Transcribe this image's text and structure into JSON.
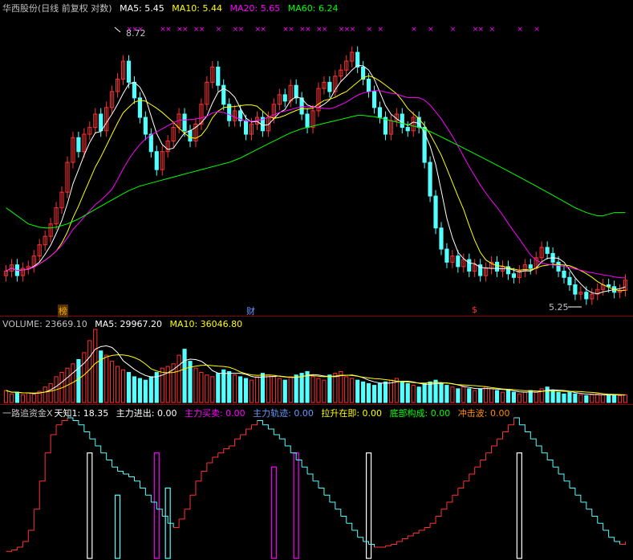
{
  "main_header": {
    "stock": "华西股份",
    "mode": "(日线 前复权 对数)",
    "ma5": "MA5: 5.45",
    "ma10": "MA10: 5.44",
    "ma20": "MA20: 5.65",
    "ma60": "MA60: 6.24"
  },
  "annotations": {
    "high": "8.72",
    "low": "5.25",
    "bang": "榜",
    "cai": "财",
    "dollar": "$"
  },
  "volume_header": {
    "volume": "VOLUME: 23669.10",
    "ma5": "MA5: 29967.20",
    "ma10": "MA10: 36046.80"
  },
  "indicator_header": {
    "name": "一路追资金X",
    "tianzhi": "天知1: 18.35",
    "zlyc": "主力进出: 0.00",
    "zlmm": "主力买卖: 0.00",
    "zlgj": "主力轨迹: 0.00",
    "lszj": "拉升在即: 0.00",
    "dbgc": "底部构成: 0.00",
    "cjb": "冲击波: 0.00"
  },
  "colors": {
    "up": "#ff3232",
    "down": "#54ffff",
    "ma5": "#ffffff",
    "ma10": "#ffff00",
    "ma20": "#ff00ff",
    "ma60": "#00ff00",
    "marker": "#ff00ff",
    "white": "#ffffff",
    "label_gray": "#c0c0c0",
    "label_blue": "#6699ff",
    "label_orange": "#ff8c00",
    "label_green": "#00ff00"
  },
  "chart_data": [
    {
      "type": "candlestick",
      "title": "华西股份 (日线 前复权 对数)",
      "ylim": [
        5.1,
        9.1
      ],
      "close": [
        5.55,
        5.62,
        5.5,
        5.58,
        5.6,
        5.72,
        5.85,
        5.95,
        6.1,
        6.3,
        6.5,
        6.9,
        7.25,
        7.05,
        7.3,
        7.4,
        7.6,
        7.35,
        7.7,
        7.95,
        8.15,
        8.45,
        8.1,
        7.85,
        7.55,
        7.3,
        7.05,
        6.8,
        7.05,
        7.2,
        7.4,
        7.6,
        7.35,
        7.2,
        7.45,
        7.75,
        8.1,
        8.35,
        8.05,
        7.75,
        7.5,
        7.65,
        7.5,
        7.3,
        7.45,
        7.55,
        7.35,
        7.55,
        7.75,
        7.9,
        7.8,
        8.05,
        7.85,
        7.6,
        7.4,
        7.65,
        8.0,
        8.1,
        7.95,
        8.2,
        8.3,
        8.45,
        8.6,
        8.35,
        8.15,
        7.95,
        7.7,
        7.55,
        7.3,
        7.5,
        7.6,
        7.4,
        7.35,
        7.55,
        7.4,
        6.9,
        6.45,
        6.05,
        5.8,
        5.65,
        5.72,
        5.6,
        5.68,
        5.55,
        5.62,
        5.5,
        5.58,
        5.65,
        5.55,
        5.6,
        5.52,
        5.48,
        5.55,
        5.62,
        5.58,
        5.7,
        5.82,
        5.75,
        5.65,
        5.55,
        5.48,
        5.4,
        5.3,
        5.32,
        5.25,
        5.3,
        5.35,
        5.4,
        5.38,
        5.32,
        5.34,
        5.45
      ],
      "open": [
        5.5,
        5.55,
        5.62,
        5.5,
        5.58,
        5.6,
        5.72,
        5.85,
        5.95,
        6.1,
        6.3,
        6.5,
        6.9,
        7.25,
        7.05,
        7.3,
        7.4,
        7.6,
        7.35,
        7.7,
        7.95,
        8.15,
        8.45,
        8.1,
        7.85,
        7.55,
        7.3,
        7.05,
        6.8,
        7.05,
        7.2,
        7.4,
        7.6,
        7.35,
        7.2,
        7.45,
        7.75,
        8.1,
        8.35,
        8.05,
        7.75,
        7.5,
        7.65,
        7.5,
        7.3,
        7.45,
        7.55,
        7.35,
        7.55,
        7.75,
        7.9,
        7.8,
        8.05,
        7.85,
        7.6,
        7.4,
        7.65,
        8.0,
        8.1,
        7.95,
        8.2,
        8.3,
        8.45,
        8.6,
        8.35,
        8.15,
        7.95,
        7.7,
        7.55,
        7.3,
        7.5,
        7.6,
        7.4,
        7.35,
        7.55,
        7.4,
        6.9,
        6.45,
        6.05,
        5.8,
        5.65,
        5.72,
        5.6,
        5.68,
        5.55,
        5.62,
        5.5,
        5.58,
        5.65,
        5.55,
        5.6,
        5.52,
        5.48,
        5.55,
        5.62,
        5.58,
        5.7,
        5.82,
        5.75,
        5.65,
        5.55,
        5.48,
        5.4,
        5.3,
        5.32,
        5.25,
        5.3,
        5.35,
        5.4,
        5.38,
        5.32,
        5.34
      ],
      "ma60": [
        6.3,
        6.25,
        6.2,
        6.15,
        6.1,
        6.08,
        6.06,
        6.05,
        6.05,
        6.06,
        6.08,
        6.1,
        6.13,
        6.16,
        6.2,
        6.24,
        6.28,
        6.32,
        6.36,
        6.4,
        6.44,
        6.48,
        6.52,
        6.55,
        6.58,
        6.6,
        6.62,
        6.64,
        6.66,
        6.68,
        6.7,
        6.72,
        6.74,
        6.76,
        6.78,
        6.8,
        6.82,
        6.84,
        6.86,
        6.88,
        6.9,
        6.93,
        6.96,
        7.0,
        7.04,
        7.08,
        7.12,
        7.16,
        7.2,
        7.24,
        7.28,
        7.32,
        7.35,
        7.38,
        7.4,
        7.42,
        7.44,
        7.46,
        7.48,
        7.5,
        7.52,
        7.54,
        7.56,
        7.58,
        7.58,
        7.57,
        7.56,
        7.54,
        7.52,
        7.5,
        7.48,
        7.46,
        7.44,
        7.42,
        7.4,
        7.37,
        7.34,
        7.3,
        7.26,
        7.22,
        7.18,
        7.14,
        7.1,
        7.06,
        7.02,
        6.98,
        6.94,
        6.9,
        6.86,
        6.82,
        6.78,
        6.74,
        6.7,
        6.66,
        6.62,
        6.58,
        6.54,
        6.5,
        6.46,
        6.42,
        6.38,
        6.34,
        6.3,
        6.27,
        6.24,
        6.22,
        6.2,
        6.2,
        6.22,
        6.24,
        6.24,
        6.24
      ]
    },
    {
      "type": "bar",
      "title": "VOLUME",
      "values": [
        14,
        10,
        12,
        9,
        11,
        10,
        13,
        18,
        22,
        30,
        35,
        40,
        45,
        50,
        58,
        72,
        85,
        60,
        55,
        48,
        42,
        38,
        35,
        30,
        28,
        26,
        30,
        35,
        40,
        42,
        45,
        55,
        62,
        48,
        40,
        35,
        32,
        30,
        34,
        38,
        36,
        32,
        30,
        28,
        26,
        30,
        34,
        32,
        30,
        28,
        26,
        30,
        32,
        34,
        36,
        30,
        28,
        26,
        32,
        34,
        36,
        30,
        28,
        26,
        24,
        22,
        20,
        22,
        24,
        26,
        28,
        24,
        22,
        20,
        18,
        22,
        24,
        26,
        22,
        20,
        18,
        16,
        18,
        16,
        14,
        16,
        18,
        16,
        14,
        12,
        14,
        12,
        10,
        12,
        14,
        12,
        16,
        18,
        14,
        12,
        10,
        12,
        10,
        9,
        8,
        9,
        10,
        9,
        8,
        9,
        8,
        9
      ]
    },
    {
      "type": "line",
      "title": "一路追资金X",
      "values": [
        5,
        6,
        8,
        12,
        20,
        35,
        55,
        75,
        88,
        95,
        98,
        100,
        98,
        95,
        90,
        85,
        80,
        75,
        70,
        65,
        62,
        60,
        58,
        55,
        50,
        45,
        40,
        35,
        30,
        25,
        22,
        28,
        35,
        45,
        55,
        62,
        68,
        72,
        75,
        78,
        80,
        85,
        88,
        92,
        95,
        98,
        95,
        92,
        88,
        85,
        80,
        75,
        70,
        65,
        60,
        55,
        50,
        45,
        40,
        35,
        30,
        25,
        20,
        15,
        12,
        10,
        8,
        8,
        9,
        10,
        12,
        14,
        16,
        18,
        20,
        22,
        25,
        30,
        35,
        40,
        45,
        50,
        55,
        60,
        65,
        70,
        75,
        80,
        85,
        90,
        95,
        100,
        95,
        90,
        85,
        80,
        75,
        70,
        65,
        60,
        55,
        50,
        45,
        40,
        35,
        30,
        25,
        20,
        15,
        12,
        10,
        12
      ]
    }
  ]
}
